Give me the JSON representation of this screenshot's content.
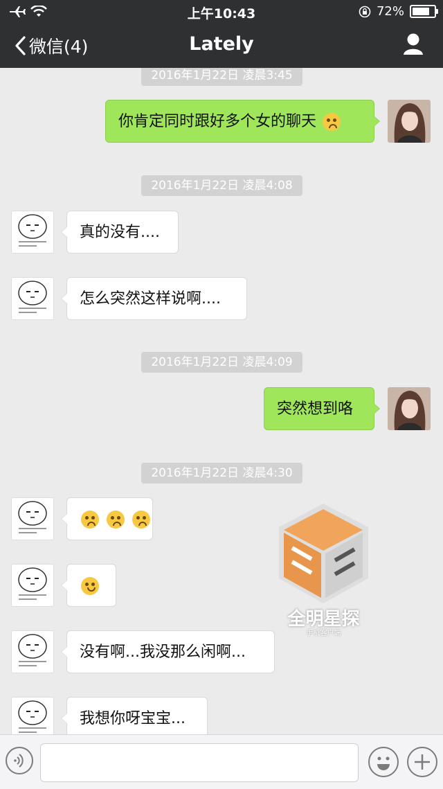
{
  "status_bar": {
    "time": "上午10:43",
    "battery_percent": "72%",
    "battery_level": 0.72
  },
  "nav": {
    "back_label": "微信(4)",
    "title": "Lately",
    "profile_icon": "person-icon"
  },
  "messages": [
    {
      "type": "timestamp",
      "text": "2016年1月22日 凌晨3:45"
    },
    {
      "type": "out",
      "text": "你肯定同时跟好多个女的聊天",
      "emoji": [
        "shy-face-emoji"
      ]
    },
    {
      "type": "timestamp",
      "text": "2016年1月22日 凌晨4:08"
    },
    {
      "type": "in",
      "text": "真的没有...."
    },
    {
      "type": "in",
      "text": "怎么突然这样说啊...."
    },
    {
      "type": "timestamp",
      "text": "2016年1月22日 凌晨4:09"
    },
    {
      "type": "out",
      "text": "突然想到咯"
    },
    {
      "type": "timestamp",
      "text": "2016年1月22日 凌晨4:30"
    },
    {
      "type": "in",
      "text": "",
      "emoji": [
        "blush-face-emoji",
        "blush-face-emoji",
        "blush-face-emoji"
      ]
    },
    {
      "type": "in",
      "text": "",
      "emoji": [
        "sad-face-emoji"
      ]
    },
    {
      "type": "in",
      "text": "没有啊...我没那么闲啊..."
    },
    {
      "type": "in",
      "text": "我想你呀宝宝..."
    }
  ],
  "watermark": {
    "text": "全明星探",
    "subtext": "手机客户端"
  },
  "input_bar": {
    "voice_icon": "voice-icon",
    "emoji_icon": "smiley-icon",
    "plus_icon": "plus-icon"
  },
  "colors": {
    "header_bg": "#2e3032",
    "chat_bg": "#ebebeb",
    "outgoing_bubble": "#a0e65b",
    "incoming_bubble": "#ffffff",
    "timestamp_bg": "#d2d2d2"
  }
}
